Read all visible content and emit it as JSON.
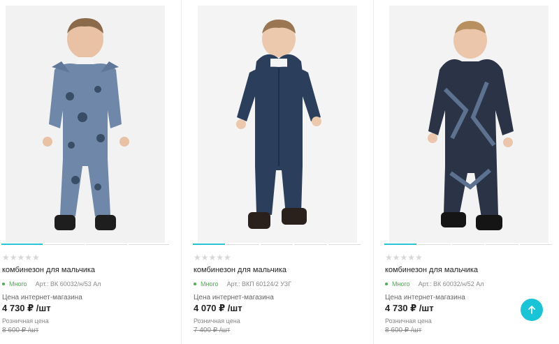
{
  "products": [
    {
      "rating_stars": "★★★★★",
      "title": "комбинезон для мальчика",
      "stock": "Много",
      "article": "Арт.: ВК 60032/н/53 Ал",
      "price_label": "Цена интернет-магазина",
      "price": "4 730 ₽ /шт",
      "retail_label": "Розничная цена",
      "retail_price": "8 600 ₽ /шт",
      "suit_color": "#6f87a8",
      "photo_slides": 4,
      "active_slide": 1
    },
    {
      "rating_stars": "★★★★★",
      "title": "комбинезон для мальчика",
      "stock": "Много",
      "article": "Арт.: ВКП 60124/2 УЗГ",
      "price_label": "Цена интернет-магазина",
      "price": "4 070 ₽ /шт",
      "retail_label": "Розничная цена",
      "retail_price": "7 400 ₽ /шт",
      "suit_color": "#2b3f5c",
      "photo_slides": 5,
      "active_slide": 1
    },
    {
      "rating_stars": "★★★★★",
      "title": "комбинезон для мальчика",
      "stock": "Много",
      "article": "Арт.: ВК 60032/н/52 Ал",
      "price_label": "Цена интернет-магазина",
      "price": "4 730 ₽ /шт",
      "retail_label": "Розничная цена",
      "retail_price": "8 600 ₽ /шт",
      "suit_color": "#2a3446",
      "photo_slides": 5,
      "active_slide": 1
    }
  ],
  "scroll_top_icon": "arrow-up-icon",
  "colors": {
    "accent": "#19c4d6",
    "in_stock": "#4caf50"
  }
}
